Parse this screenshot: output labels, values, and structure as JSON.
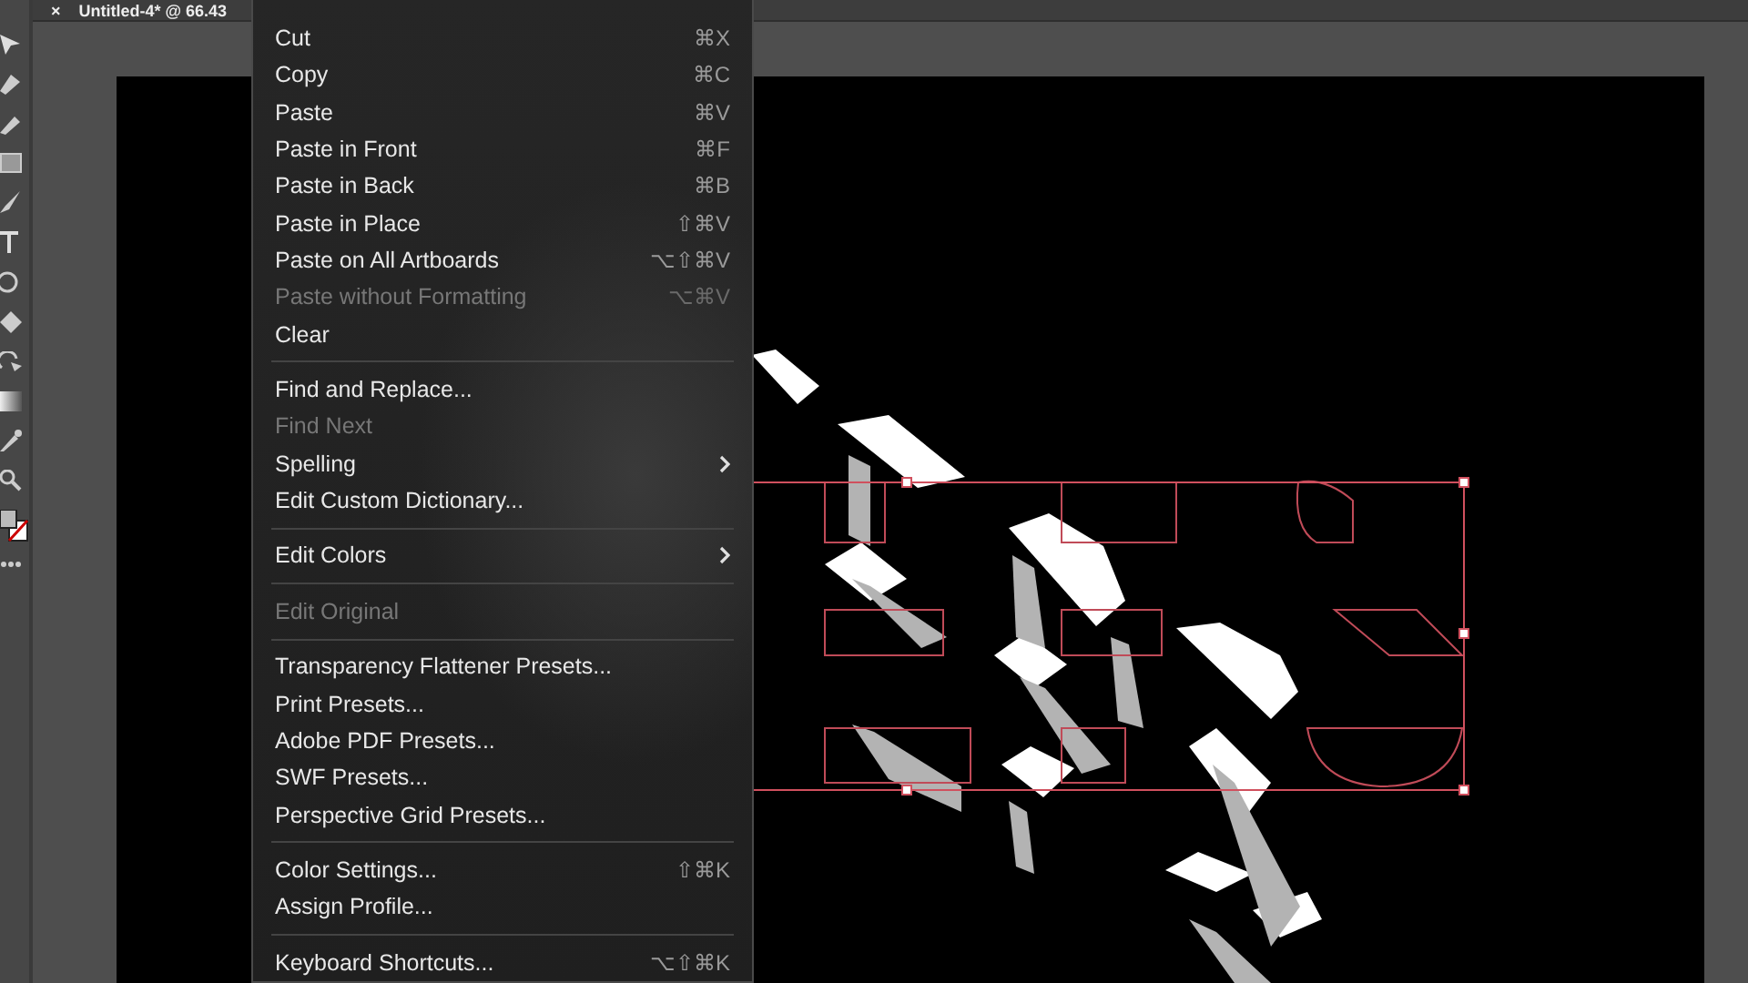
{
  "document_tab": {
    "close": "×",
    "title": "Untitled-4* @ 66.43"
  },
  "edit_menu": {
    "items": [
      {
        "kind": "item",
        "label": "Cut",
        "shortcut": "⌘X",
        "disabled": false,
        "submenu": false
      },
      {
        "kind": "item",
        "label": "Copy",
        "shortcut": "⌘C",
        "disabled": false,
        "submenu": false
      },
      {
        "kind": "item",
        "label": "Paste",
        "shortcut": "⌘V",
        "disabled": false,
        "submenu": false
      },
      {
        "kind": "item",
        "label": "Paste in Front",
        "shortcut": "⌘F",
        "disabled": false,
        "submenu": false
      },
      {
        "kind": "item",
        "label": "Paste in Back",
        "shortcut": "⌘B",
        "disabled": false,
        "submenu": false
      },
      {
        "kind": "item",
        "label": "Paste in Place",
        "shortcut": "⇧⌘V",
        "disabled": false,
        "submenu": false
      },
      {
        "kind": "item",
        "label": "Paste on All Artboards",
        "shortcut": "⌥⇧⌘V",
        "disabled": false,
        "submenu": false
      },
      {
        "kind": "item",
        "label": "Paste without Formatting",
        "shortcut": "⌥⌘V",
        "disabled": true,
        "submenu": false
      },
      {
        "kind": "item",
        "label": "Clear",
        "disabled": false,
        "submenu": false
      },
      {
        "kind": "separator"
      },
      {
        "kind": "item",
        "label": "Find and Replace...",
        "disabled": false,
        "submenu": false
      },
      {
        "kind": "item",
        "label": "Find Next",
        "disabled": true,
        "submenu": false
      },
      {
        "kind": "item",
        "label": "Spelling",
        "disabled": false,
        "submenu": true
      },
      {
        "kind": "item",
        "label": "Edit Custom Dictionary...",
        "disabled": false,
        "submenu": false
      },
      {
        "kind": "separator"
      },
      {
        "kind": "item",
        "label": "Edit Colors",
        "disabled": false,
        "submenu": true
      },
      {
        "kind": "separator"
      },
      {
        "kind": "item",
        "label": "Edit Original",
        "disabled": true,
        "submenu": false
      },
      {
        "kind": "separator"
      },
      {
        "kind": "item",
        "label": "Transparency Flattener Presets...",
        "disabled": false,
        "submenu": false
      },
      {
        "kind": "item",
        "label": "Print Presets...",
        "disabled": false,
        "submenu": false
      },
      {
        "kind": "item",
        "label": "Adobe PDF Presets...",
        "disabled": false,
        "submenu": false
      },
      {
        "kind": "item",
        "label": "SWF Presets...",
        "disabled": false,
        "submenu": false
      },
      {
        "kind": "item",
        "label": "Perspective Grid Presets...",
        "disabled": false,
        "submenu": false
      },
      {
        "kind": "separator"
      },
      {
        "kind": "item",
        "label": "Color Settings...",
        "shortcut": "⇧⌘K",
        "disabled": false,
        "submenu": false
      },
      {
        "kind": "item",
        "label": "Assign Profile...",
        "disabled": false,
        "submenu": false
      },
      {
        "kind": "separator"
      },
      {
        "kind": "item",
        "label": "Keyboard Shortcuts...",
        "shortcut": "⌥⇧⌘K",
        "disabled": false,
        "submenu": false
      }
    ]
  }
}
